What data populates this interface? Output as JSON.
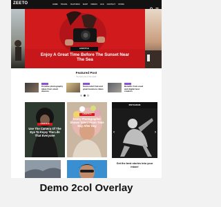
{
  "site": {
    "logo": "ZEETO"
  },
  "nav": {
    "menu": [
      "HOME",
      "TRAVEL",
      "FEATURES",
      "SHOP",
      "VIDEOS",
      "LIFE",
      "CONTACT",
      "STORE"
    ]
  },
  "hero": {
    "category": "LIFESTYLE",
    "title": "Enjoy A Great Time Before The Sunset Near The Sea"
  },
  "featured": {
    "title": "Featured Post",
    "subtitle": "the best post of the week",
    "items": [
      {
        "title": "Creative photography ideas from smart devices"
      },
      {
        "title": "Successful fruit and great business ideas"
      },
      {
        "title": "Benefits from used and digital best creators"
      }
    ],
    "active_dot": 1
  },
  "posts": [
    {
      "category": "LIFESTYLE",
      "title": "Use The Camera Of The Eye To Enjoy The Life That Everyone"
    },
    {
      "category": "LIFESTYLE",
      "title": "Every Photographer Shows Talent From Time Day After Day"
    }
  ],
  "sidebar": {
    "heading": "INSTAGRAM"
  },
  "newsletter": {
    "title": "Get the best stories into your inbox!"
  },
  "caption": "Demo 2col Overlay",
  "colors": {
    "accent": "#d11a1c",
    "badge": "#8b4fd8",
    "nav": "#121212"
  }
}
